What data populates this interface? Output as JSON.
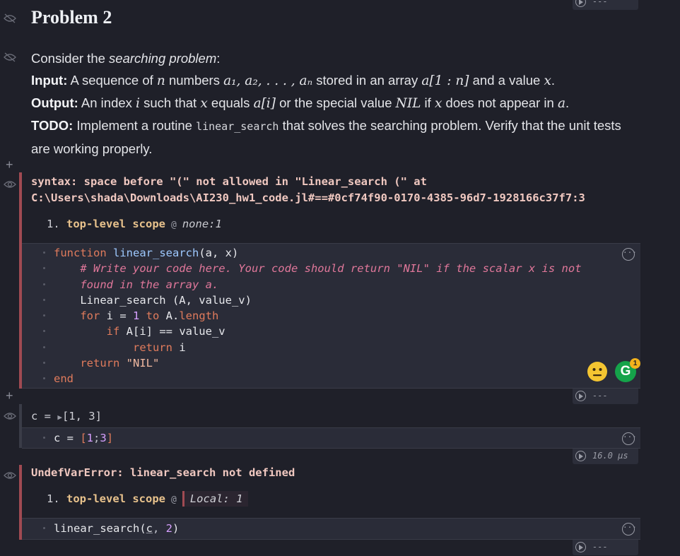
{
  "problem": {
    "title": "Problem 2",
    "intro_pre": "Consider the ",
    "intro_em": "searching problem",
    "intro_post": ":",
    "input_label": "Input:",
    "input_text_1": " A sequence of ",
    "input_math_n": "n",
    "input_text_2": " numbers ",
    "input_math_seq": "a₁, a₂, . . . , aₙ",
    "input_text_3": " stored in an array ",
    "input_math_arr": "a[1 : n]",
    "input_text_4": " and a value ",
    "input_math_x": "x",
    "input_text_5": ".",
    "output_label": "Output:",
    "output_text_1": " An index ",
    "output_math_i": "i",
    "output_text_2": " such that ",
    "output_math_x": "x",
    "output_text_3": " equals ",
    "output_math_ai": "a[i]",
    "output_text_4": " or the special value ",
    "output_math_nil": "NIL",
    "output_text_5": " if ",
    "output_math_x2": "x",
    "output_text_6": " does not appear in ",
    "output_math_a": "a",
    "output_text_7": ".",
    "todo_label": "TODO:",
    "todo_text_1": " Implement a routine ",
    "todo_code": "linear_search",
    "todo_text_2": " that solves the searching problem. Verify that the unit tests are working properly."
  },
  "cell1": {
    "error_line1": "syntax: space before \"(\" not allowed in \"Linear_search (\" at",
    "error_line2": "C:\\Users\\shada\\Downloads\\AI230_hw1_code.jl#==#0cf74f90-0170-4385-96d7-1928166c37f7:3",
    "trace_num": "1.",
    "trace_fn": "top-level scope",
    "trace_at": "@",
    "trace_loc": "none:1",
    "code": {
      "l1_kw": "function",
      "l1_fn": "linear_search",
      "l1_rest": "(a, x)",
      "l2_cmt": "# Write your code here. Your code should return \"NIL\" if the scalar x is not",
      "l3_cmt": "found in the array a.",
      "l4": "Linear_search (A, value_v)",
      "l5_kw": "for",
      "l5_a": " i = ",
      "l5_num": "1",
      "l5_kw2": " to ",
      "l5_b": "A.",
      "l5_c": "length",
      "l6_kw": "if",
      "l6_rest": " A[i] == value_v",
      "l7_kw": "return",
      "l7_rest": " i",
      "l8_kw": "return",
      "l8_str": " \"NIL\"",
      "l9_kw": "end"
    },
    "more_glyph": "···"
  },
  "cell2": {
    "output_prefix": "c = ",
    "output_arrow": "▶",
    "output_value": "[1, 3]",
    "code_pre": "c = ",
    "code_open": "[",
    "code_n1": "1",
    "code_sep": ";",
    "code_n2": "3",
    "code_close": "]",
    "runtime": "16.0 μs"
  },
  "cell3": {
    "error": "UndefVarError: linear_search not defined",
    "trace_num": "1.",
    "trace_fn": "top-level scope",
    "trace_at": "@",
    "trace_loc": "Local: 1",
    "code_fn": "linear_search(",
    "code_arg": "c",
    "code_sep": ", ",
    "code_num": "2",
    "code_close": ")"
  },
  "runbar": {
    "dashes": "---"
  },
  "grammarly": {
    "letter": "G",
    "count": "1"
  },
  "colors": {
    "background": "#1f2029",
    "error_bar": "#a04a52",
    "keyword": "#e07b5c",
    "comment": "#e0779a",
    "number": "#d7a0ff"
  }
}
